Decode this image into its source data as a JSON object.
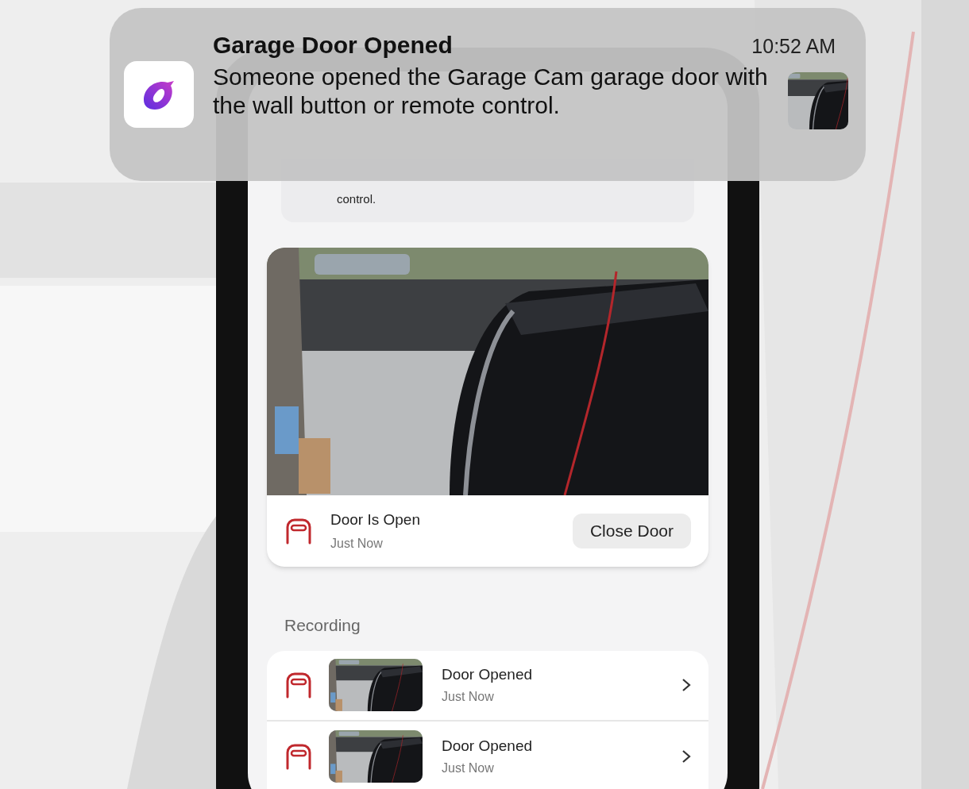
{
  "banner": {
    "title": "Garage Door Opened",
    "time": "10:52 AM",
    "message": "Someone opened the Garage Cam garage door with the wall button or remote control."
  },
  "phone": {
    "notification_tail": "control.",
    "camera_card": {
      "status": "Door Is Open",
      "status_time": "Just Now",
      "action": "Close Door"
    },
    "recording": {
      "heading": "Recording",
      "items": [
        {
          "title": "Door Opened",
          "time": "Just Now"
        },
        {
          "title": "Door Opened",
          "time": "Just Now"
        }
      ]
    }
  }
}
